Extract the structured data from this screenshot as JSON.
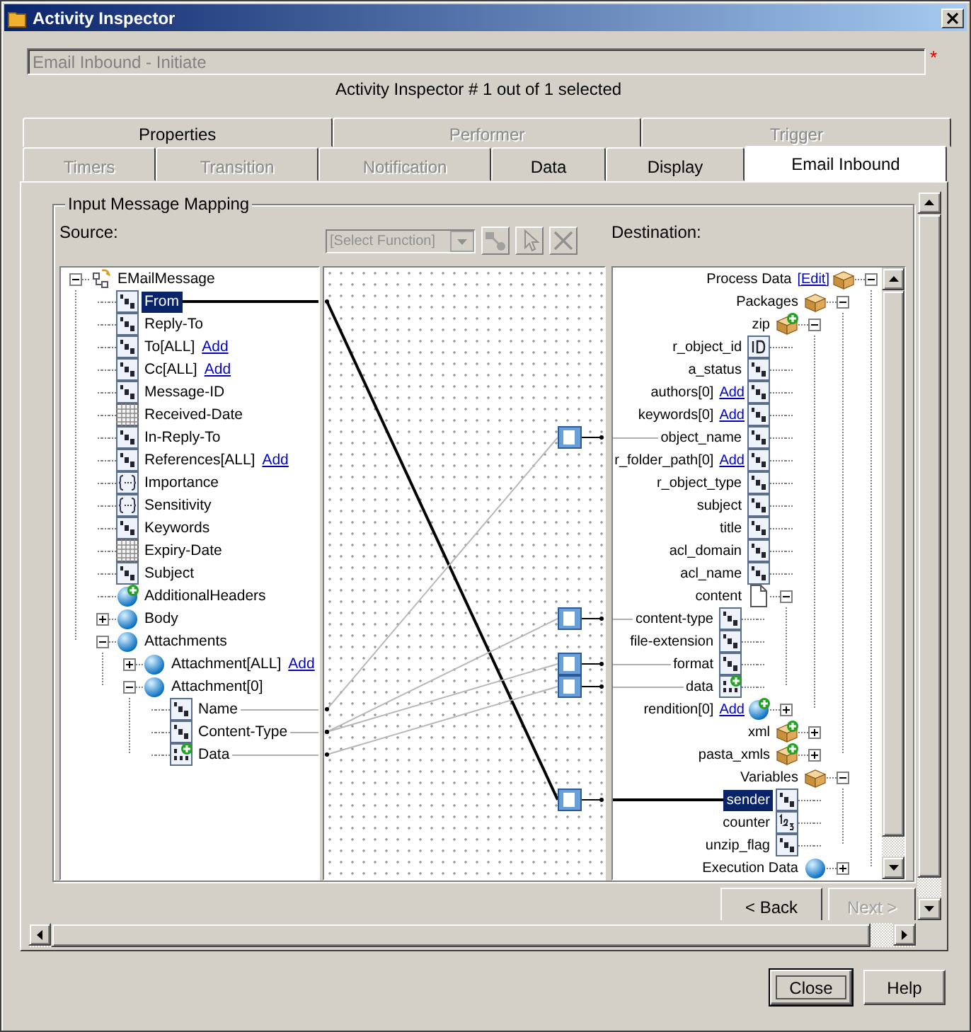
{
  "window": {
    "title": "Activity Inspector"
  },
  "activity_name": {
    "value": "Email Inbound - Initiate",
    "disabled": true,
    "required_marker": "*"
  },
  "selection_info": "Activity Inspector # 1 out of 1 selected",
  "tab_rows": [
    [
      {
        "label": "Properties",
        "disabled": false,
        "selected": false
      },
      {
        "label": "Performer",
        "disabled": true,
        "selected": false
      },
      {
        "label": "Trigger",
        "disabled": true,
        "selected": false
      }
    ],
    [
      {
        "label": "Timers",
        "disabled": true,
        "selected": false
      },
      {
        "label": "Transition",
        "disabled": true,
        "selected": false
      },
      {
        "label": "Notification",
        "disabled": true,
        "selected": false
      },
      {
        "label": "Data",
        "disabled": false,
        "selected": false
      },
      {
        "label": "Display",
        "disabled": false,
        "selected": false
      },
      {
        "label": "Email Inbound",
        "disabled": false,
        "selected": true
      }
    ]
  ],
  "mapping": {
    "title": "Input Message Mapping",
    "source_label": "Source:",
    "destination_label": "Destination:",
    "function_select": {
      "value": "[Select Function]",
      "disabled": true
    },
    "source_tree": [
      {
        "label": "EMailMessage",
        "kind": "root",
        "selected": false,
        "expanded": true,
        "children": [
          {
            "label": "From",
            "kind": "text",
            "selected": true
          },
          {
            "label": "Reply-To",
            "kind": "text",
            "selected": false
          },
          {
            "label": "To[ALL]",
            "kind": "text",
            "selected": false,
            "link": "Add"
          },
          {
            "label": "Cc[ALL]",
            "kind": "text",
            "selected": false,
            "link": "Add"
          },
          {
            "label": "Message-ID",
            "kind": "text",
            "selected": false
          },
          {
            "label": "Received-Date",
            "kind": "date",
            "selected": false
          },
          {
            "label": "In-Reply-To",
            "kind": "text",
            "selected": false
          },
          {
            "label": "References[ALL]",
            "kind": "text",
            "selected": false,
            "link": "Add"
          },
          {
            "label": "Importance",
            "kind": "enum",
            "selected": false
          },
          {
            "label": "Sensitivity",
            "kind": "enum",
            "selected": false
          },
          {
            "label": "Keywords",
            "kind": "text",
            "selected": false
          },
          {
            "label": "Expiry-Date",
            "kind": "date",
            "selected": false
          },
          {
            "label": "Subject",
            "kind": "text",
            "selected": false
          },
          {
            "label": "AdditionalHeaders",
            "kind": "object_add",
            "selected": false
          },
          {
            "label": "Body",
            "kind": "object",
            "selected": false,
            "expanded": false
          },
          {
            "label": "Attachments",
            "kind": "object",
            "selected": false,
            "expanded": true,
            "children": [
              {
                "label": "Attachment[ALL]",
                "kind": "object",
                "selected": false,
                "expanded": false,
                "link": "Add"
              },
              {
                "label": "Attachment[0]",
                "kind": "object",
                "selected": false,
                "expanded": true,
                "children": [
                  {
                    "label": "Name",
                    "kind": "text",
                    "selected": false
                  },
                  {
                    "label": "Content-Type",
                    "kind": "text",
                    "selected": false
                  },
                  {
                    "label": "Data",
                    "kind": "binary_add",
                    "selected": false
                  }
                ]
              }
            ]
          }
        ]
      }
    ],
    "destination_tree": [
      {
        "label": "Process Data",
        "kind": "package",
        "selected": false,
        "expanded": true,
        "link": "[Edit]",
        "children": [
          {
            "label": "Packages",
            "kind": "package",
            "selected": false,
            "expanded": true,
            "children": [
              {
                "label": "zip",
                "kind": "package_add",
                "selected": false,
                "expanded": true,
                "children": [
                  {
                    "label": "r_object_id",
                    "kind": "id",
                    "selected": false
                  },
                  {
                    "label": "a_status",
                    "kind": "text",
                    "selected": false
                  },
                  {
                    "label": "authors[0]",
                    "kind": "text",
                    "selected": false,
                    "link": "Add"
                  },
                  {
                    "label": "keywords[0]",
                    "kind": "text",
                    "selected": false,
                    "link": "Add"
                  },
                  {
                    "label": "object_name",
                    "kind": "text",
                    "selected": false
                  },
                  {
                    "label": "r_folder_path[0]",
                    "kind": "text",
                    "selected": false,
                    "link": "Add"
                  },
                  {
                    "label": "r_object_type",
                    "kind": "text",
                    "selected": false
                  },
                  {
                    "label": "subject",
                    "kind": "text",
                    "selected": false
                  },
                  {
                    "label": "title",
                    "kind": "text",
                    "selected": false
                  },
                  {
                    "label": "acl_domain",
                    "kind": "text",
                    "selected": false
                  },
                  {
                    "label": "acl_name",
                    "kind": "text",
                    "selected": false
                  },
                  {
                    "label": "content",
                    "kind": "doc",
                    "selected": false,
                    "expanded": true,
                    "children": [
                      {
                        "label": "content-type",
                        "kind": "text",
                        "selected": false
                      },
                      {
                        "label": "file-extension",
                        "kind": "text",
                        "selected": false
                      },
                      {
                        "label": "format",
                        "kind": "text",
                        "selected": false
                      },
                      {
                        "label": "data",
                        "kind": "binary_add",
                        "selected": false
                      }
                    ]
                  },
                  {
                    "label": "rendition[0]",
                    "kind": "object_add",
                    "selected": false,
                    "expanded": false,
                    "link": "Add"
                  }
                ]
              },
              {
                "label": "xml",
                "kind": "package_add",
                "selected": false,
                "expanded": false
              },
              {
                "label": "pasta_xmls",
                "kind": "package_add",
                "selected": false,
                "expanded": false
              }
            ]
          },
          {
            "label": "Variables",
            "kind": "package",
            "selected": false,
            "expanded": true,
            "children": [
              {
                "label": "sender",
                "kind": "text",
                "selected": true
              },
              {
                "label": "counter",
                "kind": "number",
                "selected": false
              },
              {
                "label": "unzip_flag",
                "kind": "text",
                "selected": false
              }
            ]
          },
          {
            "label": "Execution Data",
            "kind": "object",
            "selected": false,
            "expanded": false
          }
        ]
      }
    ],
    "mapping_canvas": {
      "kind": "connections"
    }
  },
  "wizard_buttons": [
    {
      "label": "< Back",
      "disabled": false
    },
    {
      "label": "Next >",
      "disabled": true
    }
  ],
  "buttons": [
    {
      "label": "Close",
      "default": true
    },
    {
      "label": "Help",
      "default": false
    }
  ]
}
